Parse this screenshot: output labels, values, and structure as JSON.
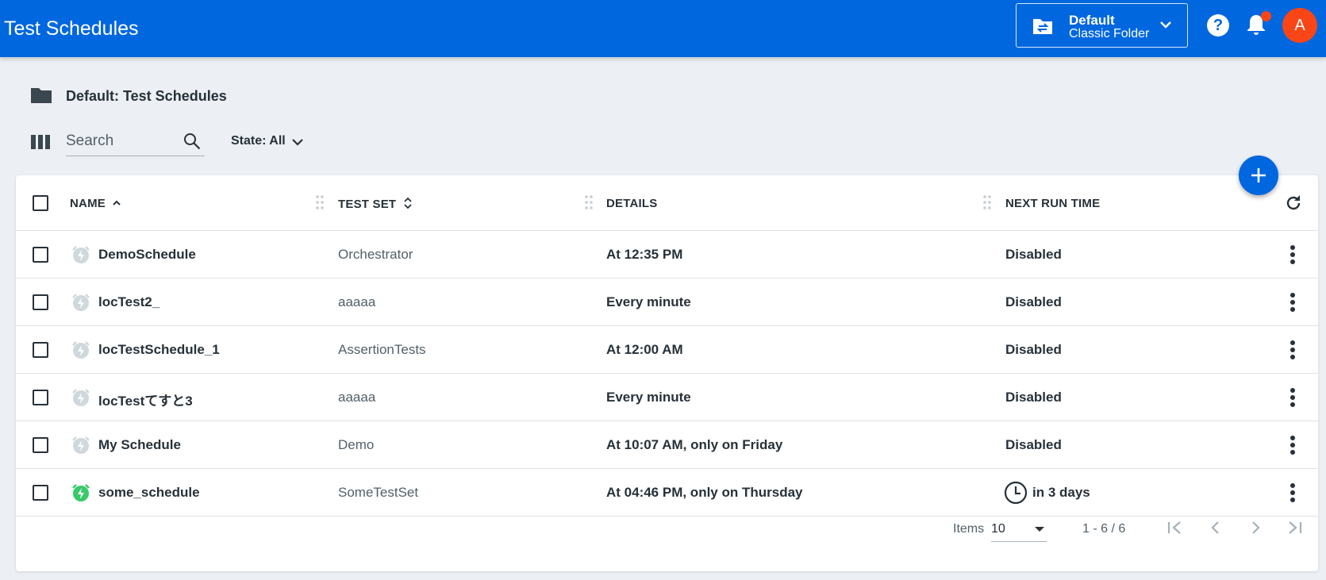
{
  "header": {
    "title": "Test Schedules",
    "folder": {
      "name": "Default",
      "type": "Classic Folder"
    },
    "help_label": "?",
    "avatar_initial": "A"
  },
  "breadcrumb": {
    "text": "Default: Test Schedules"
  },
  "toolbar": {
    "search_placeholder": "Search",
    "state_filter": "State: All"
  },
  "table": {
    "columns": {
      "name": "NAME",
      "test_set": "TEST SET",
      "details": "DETAILS",
      "next_run_time": "NEXT RUN TIME"
    },
    "rows": [
      {
        "name": "DemoSchedule",
        "test_set": "Orchestrator",
        "details": "At 12:35 PM",
        "next_run_time": "Disabled",
        "enabled": false
      },
      {
        "name": "locTest2_",
        "test_set": "aaaaa",
        "details": "Every minute",
        "next_run_time": "Disabled",
        "enabled": false
      },
      {
        "name": "locTestSchedule_1",
        "test_set": "AssertionTests",
        "details": "At 12:00 AM",
        "next_run_time": "Disabled",
        "enabled": false
      },
      {
        "name": "locTestてすと3",
        "test_set": "aaaaa",
        "details": "Every minute",
        "next_run_time": "Disabled",
        "enabled": false
      },
      {
        "name": "My Schedule",
        "test_set": "Demo",
        "details": "At 10:07 AM, only on Friday",
        "next_run_time": "Disabled",
        "enabled": false
      },
      {
        "name": "some_schedule",
        "test_set": "SomeTestSet",
        "details": "At 04:46 PM, only on Thursday",
        "next_run_time": "in 3 days",
        "enabled": true
      }
    ]
  },
  "pagination": {
    "items_label": "Items",
    "page_size": "10",
    "range": "1 - 6 / 6"
  },
  "colors": {
    "brand": "#0067df",
    "accent": "#fa4616",
    "enabled_icon": "#38c96b",
    "disabled_icon": "#cfd8dd"
  }
}
